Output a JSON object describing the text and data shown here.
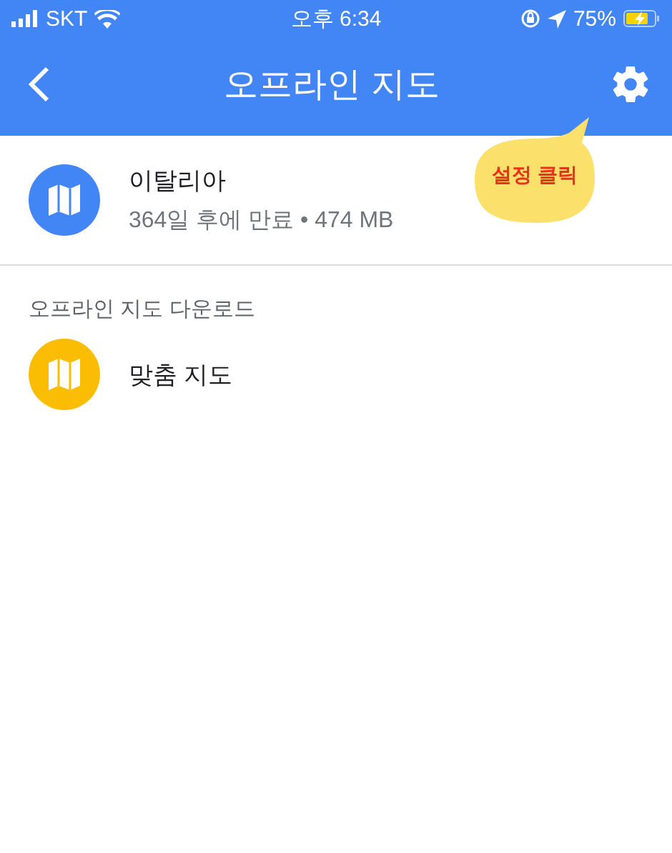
{
  "status_bar": {
    "carrier": "SKT",
    "time": "오후 6:34",
    "battery": "75%",
    "charging": true
  },
  "app_bar": {
    "title": "오프라인 지도"
  },
  "downloaded_maps": [
    {
      "name": "이탈리아",
      "detail": "364일 후에 만료 • 474 MB",
      "color": "#4285f4"
    }
  ],
  "download_section": {
    "heading": "오프라인 지도 다운로드",
    "items": [
      {
        "name": "맞춤 지도",
        "color": "#fbbc04"
      }
    ]
  },
  "callout": {
    "text": "설정 클릭"
  }
}
